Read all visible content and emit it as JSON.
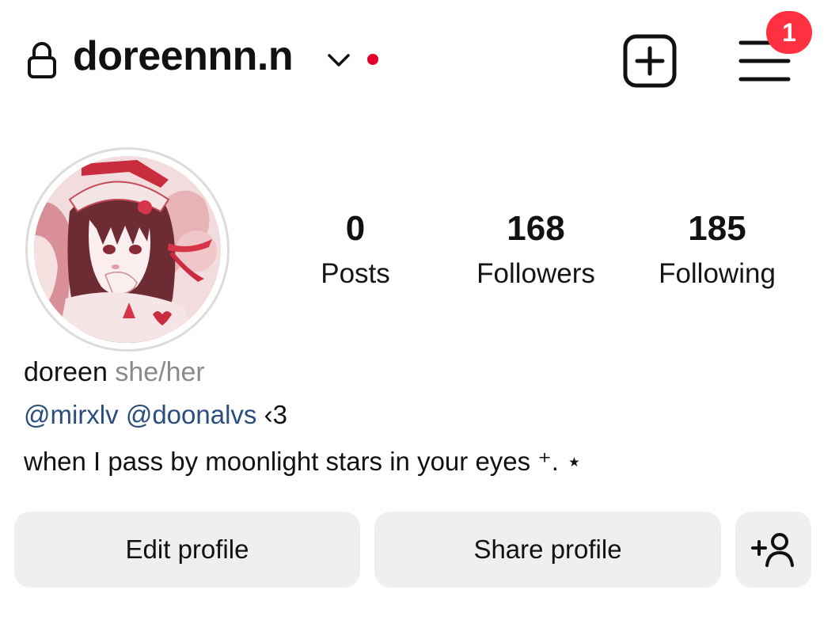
{
  "header": {
    "username": "doreennn.n",
    "notification_count": "1",
    "icons": {
      "lock": "lock-icon",
      "switch_account": "chevron-down-icon",
      "new_post": "plus-square-icon",
      "menu": "hamburger-menu-icon"
    }
  },
  "colors": {
    "accent_red": "#e3002b",
    "badge_red": "#ff3040",
    "link_blue": "#2a4f7e",
    "button_bg": "#efefef"
  },
  "profile": {
    "avatar": "profile-picture",
    "stats": [
      {
        "value": "0",
        "label": "Posts"
      },
      {
        "value": "168",
        "label": "Followers"
      },
      {
        "value": "185",
        "label": "Following"
      }
    ],
    "bio": {
      "name": "doreen",
      "pronouns": "she/her",
      "mention_1": "@mirxlv",
      "mention_2": "@doonalvs",
      "heart": "‹3",
      "text": "when I pass by moonlight stars in your eyes ⁺. ⋆"
    }
  },
  "actions": {
    "edit_label": "Edit profile",
    "share_label": "Share profile",
    "add_user_icon": "add-person-icon"
  }
}
